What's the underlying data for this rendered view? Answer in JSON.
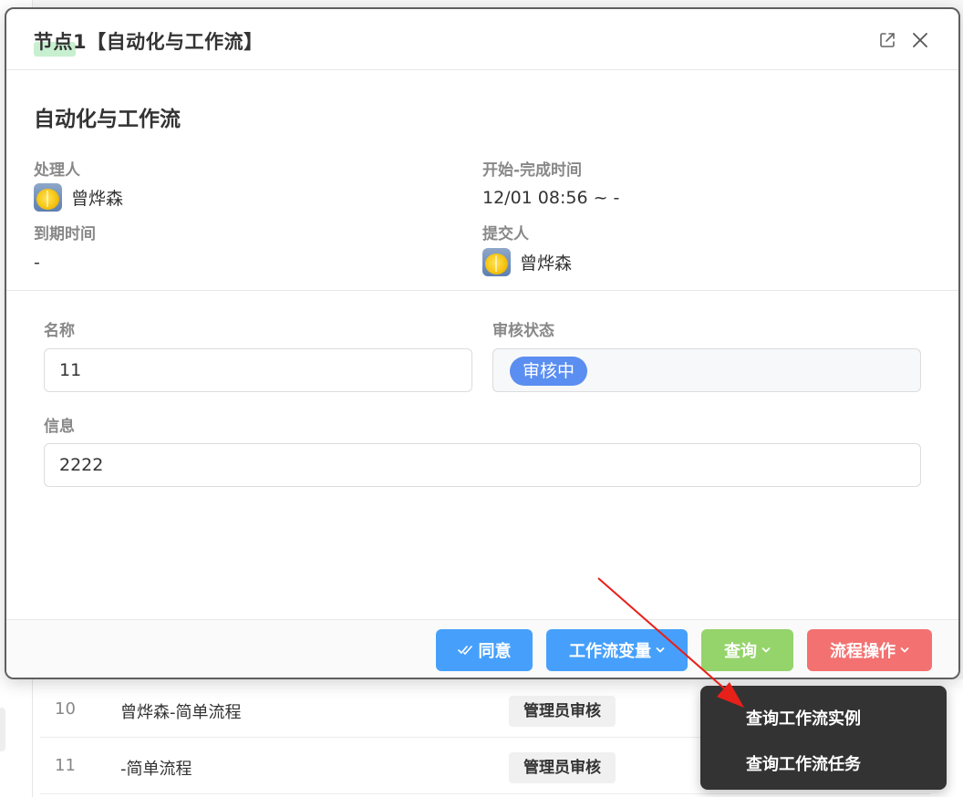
{
  "modal": {
    "title": "节点1【自动化与工作流】",
    "section_title": "自动化与工作流"
  },
  "info": {
    "handler_label": "处理人",
    "handler_name": "曾烨森",
    "time_label": "开始-完成时间",
    "time_value": "12/01 08:56 ~ -",
    "due_label": "到期时间",
    "due_value": "-",
    "submitter_label": "提交人",
    "submitter_name": "曾烨森"
  },
  "form": {
    "name_label": "名称",
    "name_value": "11",
    "status_label": "审核状态",
    "status_value": "审核中",
    "info_label": "信息",
    "info_value": "2222"
  },
  "footer": {
    "approve_label": "同意",
    "vars_label": "工作流变量",
    "query_label": "查询",
    "flow_label": "流程操作"
  },
  "dropdown": {
    "items": [
      "查询工作流实例",
      "查询工作流任务"
    ]
  },
  "background_table": {
    "rows": [
      {
        "id": "10",
        "name": "曾烨森-简单流程",
        "tag": "管理员审核"
      },
      {
        "id": "11",
        "name": "-简单流程",
        "tag": "管理员审核"
      }
    ]
  },
  "colors": {
    "primary": "#46a0fb",
    "success": "#95d36b",
    "danger": "#f37171",
    "status_pill": "#5a8ef0",
    "dropdown_bg": "#333333",
    "annotation_arrow": "#e8201a"
  }
}
